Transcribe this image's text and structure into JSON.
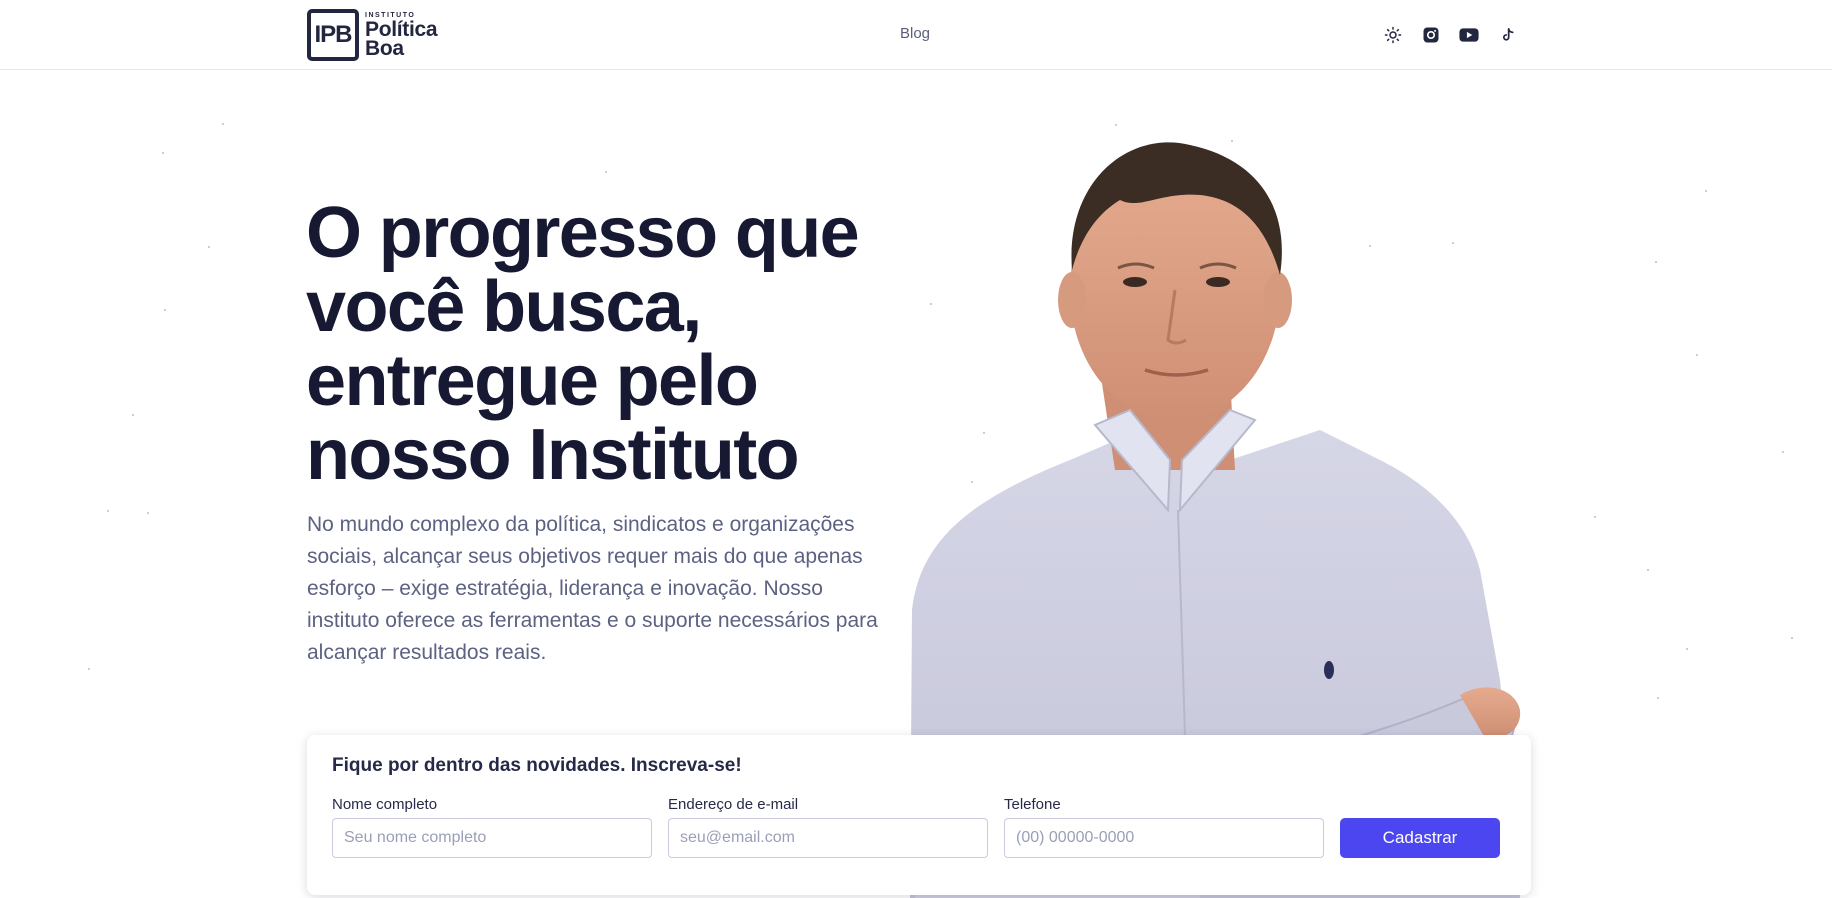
{
  "brand": {
    "mark": "IPB",
    "small": "INSTITUTO",
    "line1": "Política",
    "line2": "Boa"
  },
  "nav": {
    "blog": "Blog"
  },
  "social": [
    {
      "name": "theme-toggle",
      "icon": "sun-icon"
    },
    {
      "name": "instagram",
      "icon": "instagram-icon"
    },
    {
      "name": "youtube",
      "icon": "youtube-icon"
    },
    {
      "name": "tiktok",
      "icon": "tiktok-icon"
    }
  ],
  "hero": {
    "title_lines": [
      "O progresso que",
      "você busca,",
      "entregue pelo",
      "nosso Instituto"
    ],
    "description": "No mundo complexo da política, sindicatos e organizações sociais, alcançar seus objetivos requer mais do que apenas esforço – exige estratégia, liderança e inovação. Nosso instituto oferece as ferramentas e o suporte necessários para alcançar resultados reais."
  },
  "form": {
    "title": "Fique por dentro das novidades. Inscreva-se!",
    "name_label": "Nome completo",
    "name_placeholder": "Seu nome completo",
    "email_label": "Endereço de e-mail",
    "email_placeholder": "seu@email.com",
    "phone_label": "Telefone",
    "phone_placeholder": "(00) 00000-0000",
    "submit": "Cadastrar"
  },
  "colors": {
    "accent": "#4b46f0",
    "heading": "#171933",
    "body": "#5c6282"
  }
}
